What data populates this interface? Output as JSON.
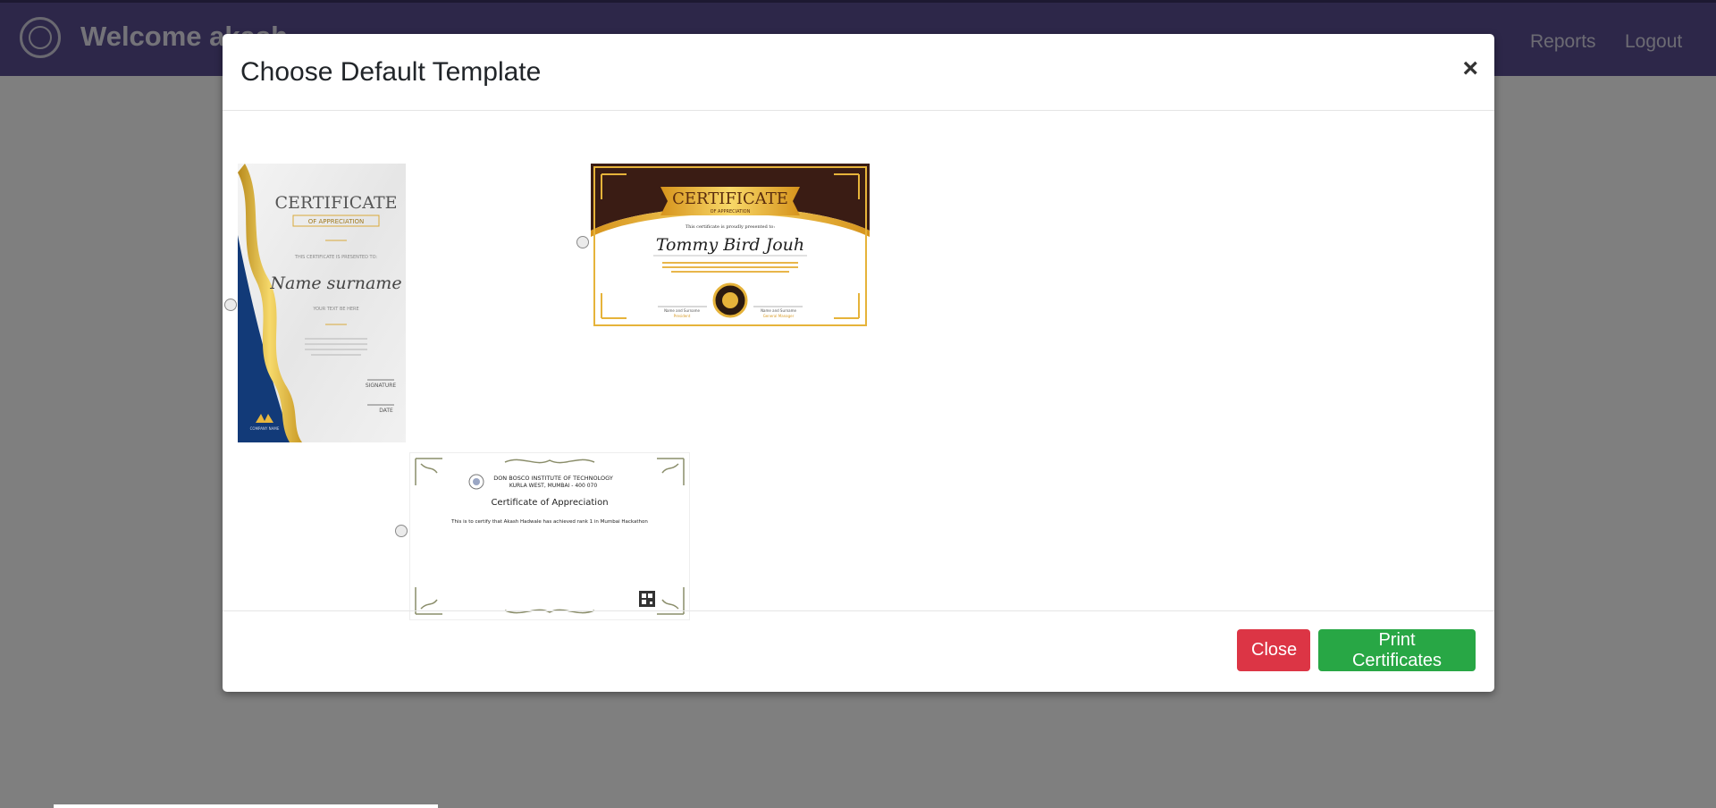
{
  "navbar": {
    "welcome_text": "Welcome akash",
    "links": [
      {
        "label": "Reports"
      },
      {
        "label": "Logout"
      }
    ]
  },
  "modal": {
    "title": "Choose Default Template",
    "close_symbol": "×",
    "templates": [
      {
        "selected": false,
        "heading": "CERTIFICATE",
        "subheading": "OF APPRECIATION",
        "presented": "THIS CERTIFICATE IS PRESENTED TO:",
        "name": "Name surname",
        "for_text": "YOUR TEXT BE HERE",
        "signature": "SIGNATURE",
        "date": "DATE",
        "company": "COMPANY NAME"
      },
      {
        "selected": false,
        "heading": "CERTIFICATE",
        "subheading": "OF APPRECIATION",
        "presented": "This certificate is proudly presented to:",
        "name": "Tommy Bird Jouh",
        "sig_left": "Name and Surname",
        "sig_left_role": "President",
        "sig_right": "Name and Surname",
        "sig_right_role": "General Manager"
      },
      {
        "selected": false,
        "institute": "DON BOSCO INSTITUTE OF TECHNOLOGY",
        "address": "KURLA WEST, MUMBAI - 400 070",
        "title": "Certificate of Appreciation",
        "body": "This is to certify that Akash Hadwale has achieved rank 1 in Mumbai Hackathon"
      }
    ],
    "buttons": {
      "close": "Close",
      "print": "Print Certificates"
    }
  },
  "colors": {
    "navbar": "#5b4f93",
    "close_button": "#dc3545",
    "print_button": "#28a745"
  }
}
